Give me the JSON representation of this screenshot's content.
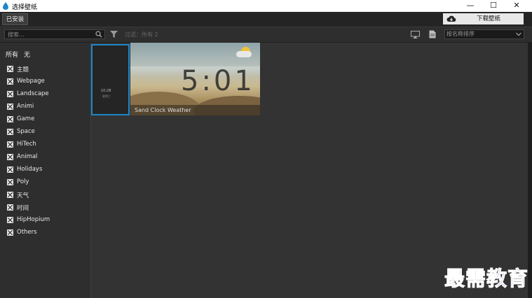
{
  "window": {
    "title": "选择壁纸",
    "min_glyph": "—",
    "max_glyph": "☐",
    "close_glyph": "✕"
  },
  "toolbar": {
    "installed_tab": "已安装",
    "download_button": "下载壁纸"
  },
  "filterbar": {
    "search_placeholder": "搜索...",
    "filter_text": "过滤：所有 2",
    "sort_label": "按名称排序"
  },
  "sidebar": {
    "select_all": "所有",
    "select_none": "无",
    "categories": [
      {
        "label": "主题",
        "checked": true
      },
      {
        "label": "Webpage",
        "checked": true
      },
      {
        "label": "Landscape",
        "checked": true
      },
      {
        "label": "Animi",
        "checked": true
      },
      {
        "label": "Game",
        "checked": true
      },
      {
        "label": "Space",
        "checked": true
      },
      {
        "label": "HiTech",
        "checked": true
      },
      {
        "label": "Animal",
        "checked": true
      },
      {
        "label": "Holidays",
        "checked": true
      },
      {
        "label": "Poly",
        "checked": true
      },
      {
        "label": "天气",
        "checked": true
      },
      {
        "label": "时间",
        "checked": true
      },
      {
        "label": "HipHopium",
        "checked": true
      },
      {
        "label": "Others",
        "checked": true
      }
    ]
  },
  "wallpapers": [
    {
      "title": "",
      "thumb_text_1": "10:28",
      "thumb_text_2": "星期三",
      "selected": true
    },
    {
      "title": "Sand Clock Weather",
      "clock": "5:01",
      "selected": false
    }
  ],
  "watermark": "最需教育",
  "colors": {
    "selection_border": "#1e86c8",
    "watermark": "#2a3ca8"
  }
}
